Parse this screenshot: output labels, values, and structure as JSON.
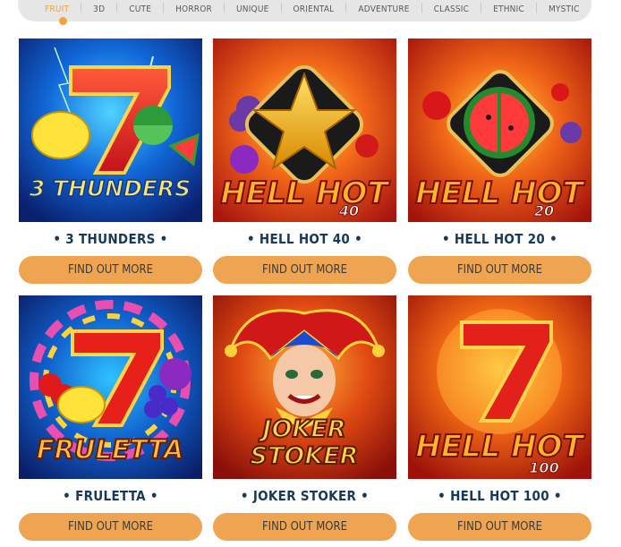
{
  "filters": {
    "items": [
      "FRUIT",
      "3D",
      "CUTE",
      "HORROR",
      "UNIQUE",
      "ORIENTAL",
      "ADVENTURE",
      "CLASSIC",
      "ETHNIC",
      "MYSTIC"
    ],
    "active": "FRUIT",
    "active_color": "#f0a43a"
  },
  "games": [
    {
      "title": "• 3 THUNDERS •",
      "logo": "3 THUNDERS",
      "button": "FIND OUT MORE"
    },
    {
      "title": "• HELL HOT 40 •",
      "logo": "HELL HOT",
      "logo_num": "40",
      "button": "FIND OUT MORE"
    },
    {
      "title": "• HELL HOT 20 •",
      "logo": "HELL HOT",
      "logo_num": "20",
      "button": "FIND OUT MORE"
    },
    {
      "title": "• FRULETTA •",
      "logo": "FRULETTA",
      "button": "FIND OUT MORE"
    },
    {
      "title": "• JOKER STOKER •",
      "logo": "JOKER",
      "logo2": "STOKER",
      "button": "FIND OUT MORE"
    },
    {
      "title": "• HELL HOT 100 •",
      "logo": "HELL HOT",
      "logo_num": "100",
      "button": "FIND OUT MORE"
    }
  ],
  "colors": {
    "button": "#eea451",
    "title": "#173a5a"
  }
}
